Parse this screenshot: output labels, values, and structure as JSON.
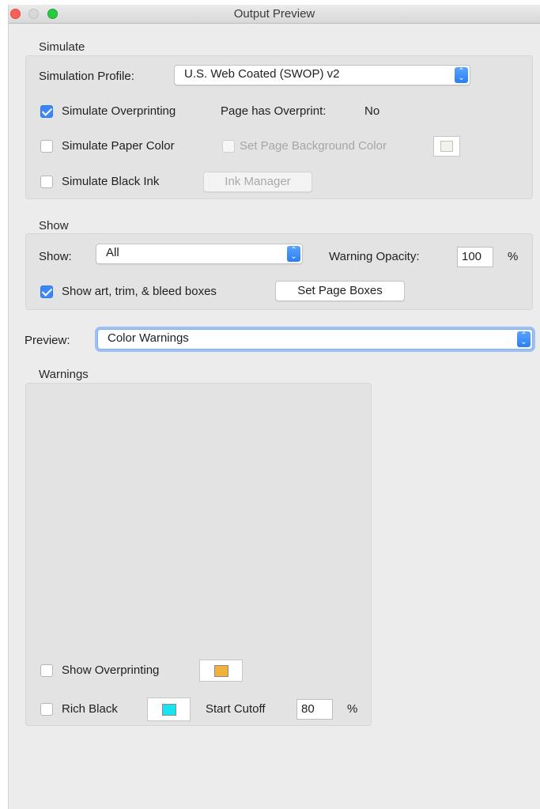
{
  "window": {
    "title": "Output Preview"
  },
  "simulate": {
    "section_label": "Simulate",
    "profile_label": "Simulation Profile:",
    "profile_value": "U.S. Web Coated (SWOP) v2",
    "overprinting": {
      "label": "Simulate Overprinting",
      "checked": true
    },
    "overprint_status_label": "Page has Overprint:",
    "overprint_status_value": "No",
    "paper_color": {
      "label": "Simulate Paper Color",
      "checked": false
    },
    "page_bg": {
      "label": "Set Page Background Color",
      "checked": false,
      "enabled": false,
      "swatch_color": "#f2f2ec"
    },
    "black_ink": {
      "label": "Simulate Black Ink",
      "checked": false
    },
    "ink_manager_label": "Ink Manager"
  },
  "show": {
    "section_label": "Show",
    "show_label": "Show:",
    "show_value": "All",
    "opacity_label": "Warning Opacity:",
    "opacity_value": "100",
    "opacity_unit": "%",
    "boxes": {
      "label": "Show art, trim, & bleed boxes",
      "checked": true
    },
    "set_page_boxes_label": "Set Page Boxes"
  },
  "preview": {
    "label": "Preview:",
    "value": "Color Warnings"
  },
  "warnings": {
    "section_label": "Warnings",
    "show_overprinting": {
      "label": "Show Overprinting",
      "checked": false,
      "swatch_color": "#f0b23c"
    },
    "rich_black": {
      "label": "Rich Black",
      "checked": false,
      "swatch_color": "#19e3f0"
    },
    "start_cutoff_label": "Start Cutoff",
    "start_cutoff_value": "80",
    "start_cutoff_unit": "%"
  },
  "colors": {
    "accent": "#3b88fd",
    "window_bg": "#ececec",
    "group_bg": "#e3e3e3"
  },
  "icons": {
    "select_arrows": "chevron-up-down-icon",
    "checkmark": "checkmark-icon"
  }
}
